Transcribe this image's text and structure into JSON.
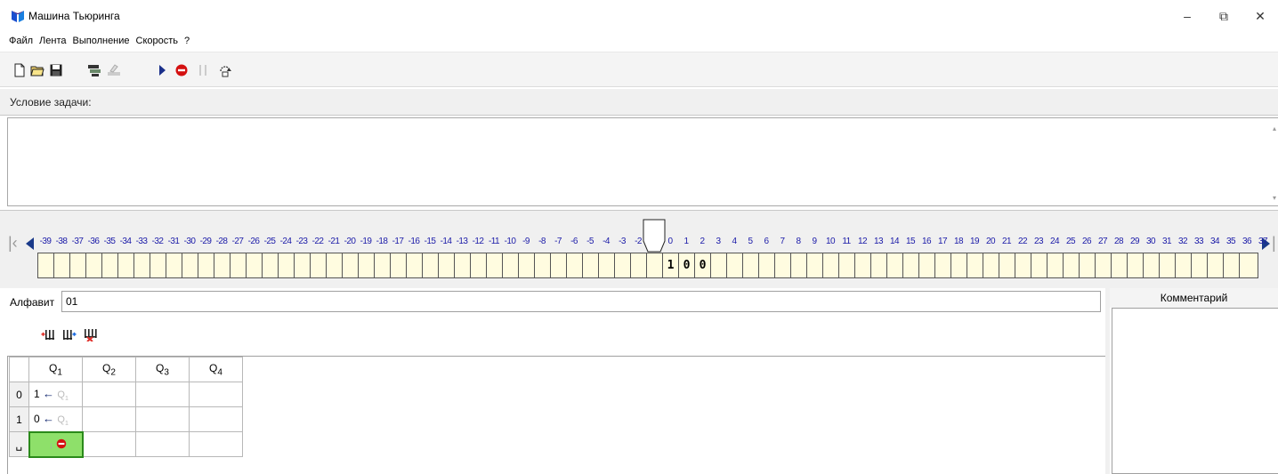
{
  "window": {
    "title": "Машина Тьюринга",
    "minimize_glyph": "–",
    "restore_glyph": "⧉",
    "close_glyph": "✕"
  },
  "menu": [
    {
      "label": "Файл"
    },
    {
      "label": "Лента"
    },
    {
      "label": "Выполнение"
    },
    {
      "label": "Скорость"
    },
    {
      "label": "?"
    }
  ],
  "toolbar": {
    "icons": [
      "new-file-icon",
      "open-folder-icon",
      "save-icon",
      "tape-load-icon",
      "tape-clear-icon",
      "run-icon",
      "stop-icon",
      "pause-icon",
      "step-icon"
    ]
  },
  "condition": {
    "label": "Условие задачи:",
    "text": ""
  },
  "tape": {
    "numbers": [
      "-39",
      "-38",
      "-37",
      "-36",
      "-35",
      "-34",
      "-33",
      "-32",
      "-31",
      "-30",
      "-29",
      "-28",
      "-27",
      "-26",
      "-25",
      "-24",
      "-23",
      "-22",
      "-21",
      "-20",
      "-19",
      "-18",
      "-17",
      "-16",
      "-15",
      "-14",
      "-13",
      "-12",
      "-11",
      "-10",
      "-9",
      "-8",
      "-7",
      "-6",
      "-5",
      "-4",
      "-3",
      "-2",
      "-1",
      "0",
      "1",
      "2",
      "3",
      "4",
      "5",
      "6",
      "7",
      "8",
      "9",
      "10",
      "11",
      "12",
      "13",
      "14",
      "15",
      "16",
      "17",
      "18",
      "19",
      "20",
      "21",
      "22",
      "23",
      "24",
      "25",
      "26",
      "27",
      "28",
      "29",
      "30",
      "31",
      "32",
      "33",
      "34",
      "35",
      "36",
      "37"
    ],
    "cells": [
      "",
      "",
      "",
      "",
      "",
      "",
      "",
      "",
      "",
      "",
      "",
      "",
      "",
      "",
      "",
      "",
      "",
      "",
      "",
      "",
      "",
      "",
      "",
      "",
      "",
      "",
      "",
      "",
      "",
      "",
      "",
      "",
      "",
      "",
      "",
      "",
      "",
      "",
      "",
      "1",
      "0",
      "0",
      "",
      "",
      "",
      "",
      "",
      "",
      "",
      "",
      "",
      "",
      "",
      "",
      "",
      "",
      "",
      "",
      "",
      "",
      "",
      "",
      "",
      "",
      "",
      "",
      "",
      "",
      "",
      "",
      "",
      "",
      "",
      "",
      ""
    ],
    "head_index": 38,
    "colors": {
      "cell_bg": "#fffce0",
      "number": "#1a1aa8",
      "nav": "#1a3a8a"
    }
  },
  "alphabet": {
    "label": "Алфавит",
    "value": "01"
  },
  "state_tools": [
    "add-state-icon",
    "insert-state-icon",
    "delete-state-icon"
  ],
  "program": {
    "columns": [
      {
        "q": "Q",
        "n": "1"
      },
      {
        "q": "Q",
        "n": "2"
      },
      {
        "q": "Q",
        "n": "3"
      },
      {
        "q": "Q",
        "n": "4"
      }
    ],
    "rows": [
      {
        "symbol": "0",
        "cells": [
          {
            "write": "1",
            "move": "←",
            "state_q": "Q",
            "state_n": "1"
          },
          null,
          null,
          null
        ]
      },
      {
        "symbol": "1",
        "cells": [
          {
            "write": "0",
            "move": "←",
            "state_q": "Q",
            "state_n": "1"
          },
          null,
          null,
          null
        ]
      },
      {
        "symbol": "␣",
        "cells": [
          {
            "write": "",
            "move": "↓",
            "halt": true,
            "selected": true
          },
          null,
          null,
          null
        ]
      }
    ]
  },
  "comment": {
    "header": "Комментарий",
    "text": ""
  }
}
